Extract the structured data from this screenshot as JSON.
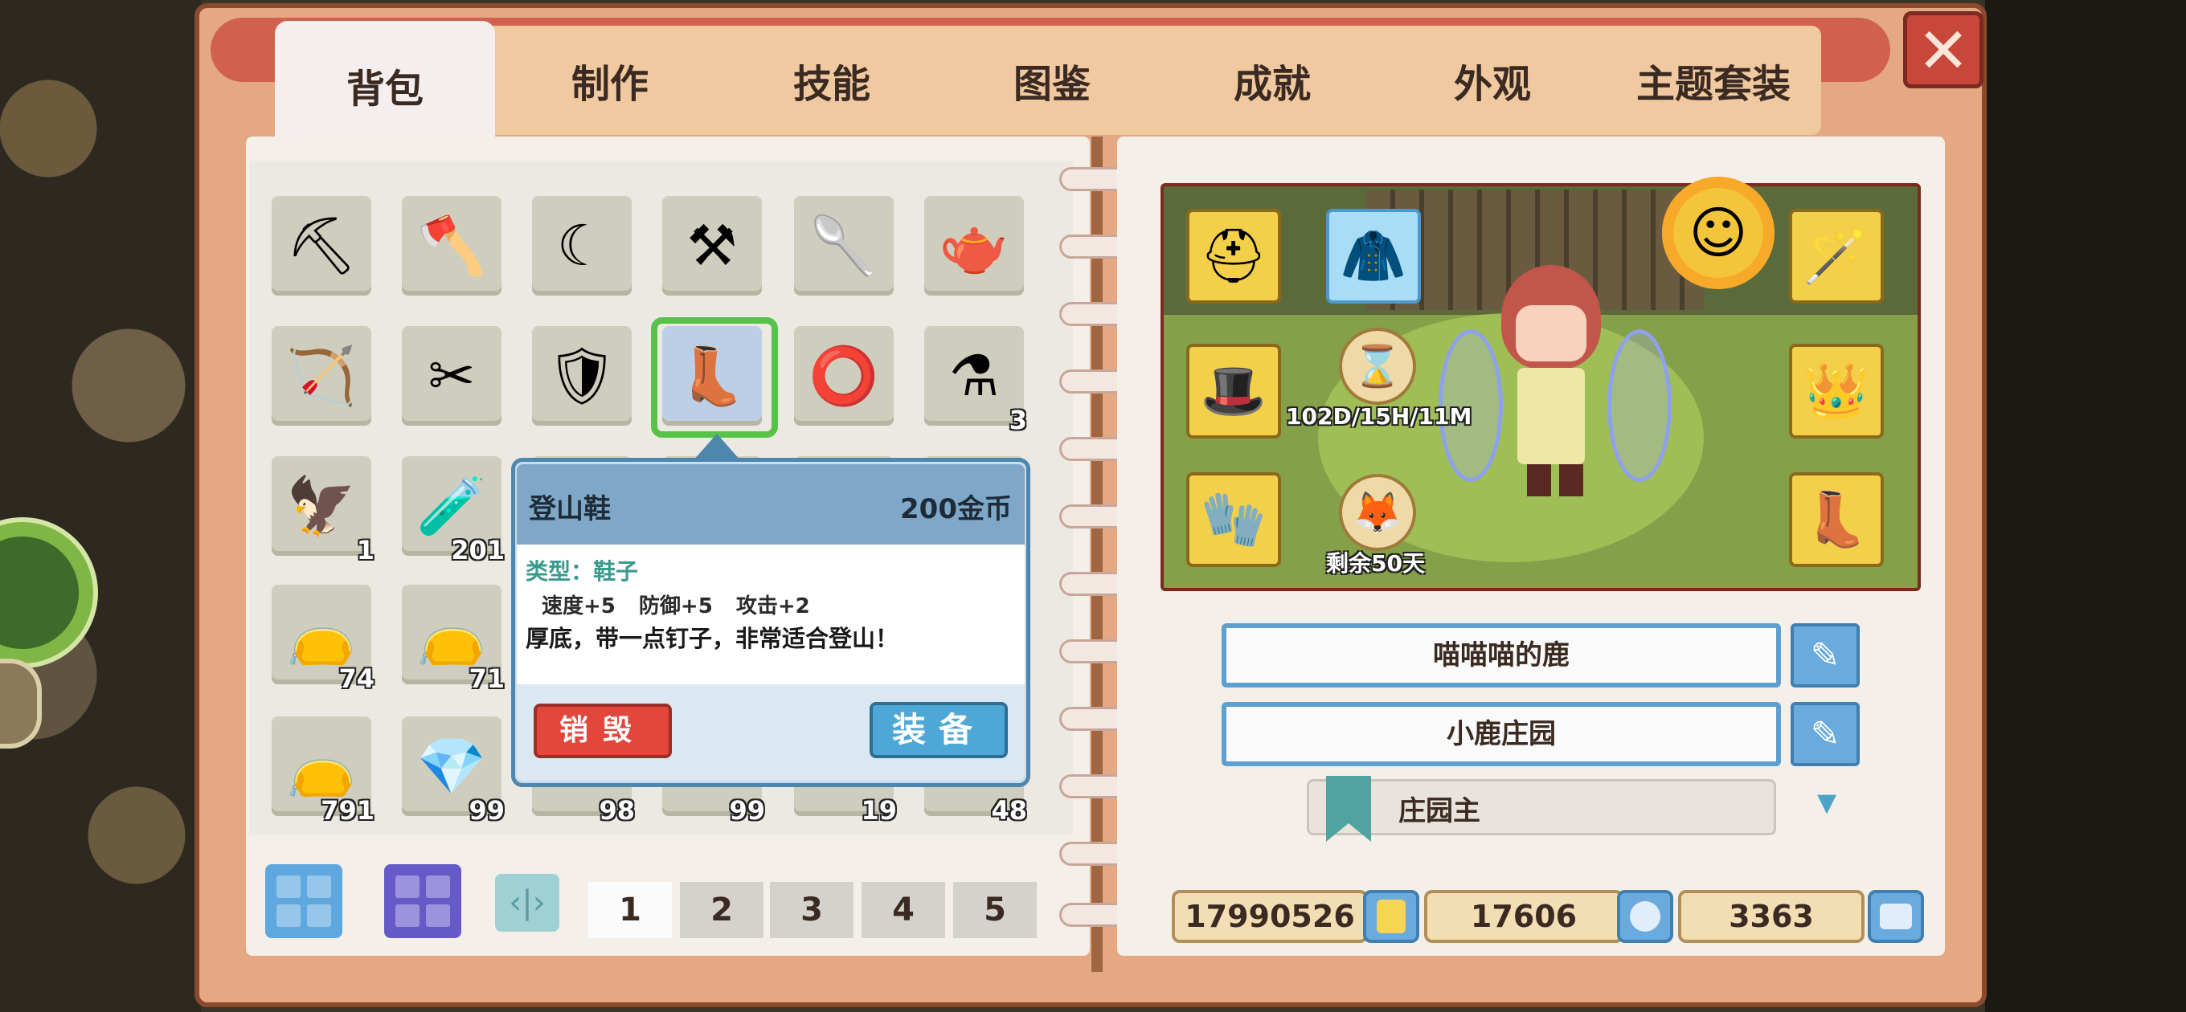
{
  "tabs": [
    "背包",
    "制作",
    "技能",
    "图鉴",
    "成就",
    "外观",
    "主题套装"
  ],
  "close_label": "✕",
  "inventory": {
    "slots": [
      {
        "icon": "pickaxe-icon",
        "glyph": "⛏",
        "count": ""
      },
      {
        "icon": "axe-icon",
        "glyph": "🪓",
        "count": ""
      },
      {
        "icon": "sickle-icon",
        "glyph": "☾",
        "count": ""
      },
      {
        "icon": "hoe-icon",
        "glyph": "⚒",
        "count": ""
      },
      {
        "icon": "shovel-icon",
        "glyph": "🥄",
        "count": ""
      },
      {
        "icon": "teapot-icon",
        "glyph": "🫖",
        "count": ""
      },
      {
        "icon": "bow-icon",
        "glyph": "🏹",
        "count": ""
      },
      {
        "icon": "scissors-icon",
        "glyph": "✂",
        "count": ""
      },
      {
        "icon": "armor-icon",
        "glyph": "🛡",
        "count": ""
      },
      {
        "icon": "boot-icon",
        "glyph": "👢",
        "count": ""
      },
      {
        "icon": "ring-icon",
        "glyph": "⭕",
        "count": ""
      },
      {
        "icon": "potion-icon",
        "glyph": "⚗",
        "count": "3"
      },
      {
        "icon": "bird-icon",
        "glyph": "🦅",
        "count": "1"
      },
      {
        "icon": "bottle-icon",
        "glyph": "🧪",
        "count": "201"
      },
      {
        "icon": "hidden",
        "glyph": "",
        "count": ""
      },
      {
        "icon": "hidden",
        "glyph": "",
        "count": ""
      },
      {
        "icon": "hidden",
        "glyph": "",
        "count": ""
      },
      {
        "icon": "hidden",
        "glyph": "",
        "count": ""
      },
      {
        "icon": "seed-bag-blue-icon",
        "glyph": "👝",
        "count": "74"
      },
      {
        "icon": "seed-bag-red-icon",
        "glyph": "👝",
        "count": "71"
      },
      {
        "icon": "hidden",
        "glyph": "",
        "count": ""
      },
      {
        "icon": "hidden",
        "glyph": "",
        "count": ""
      },
      {
        "icon": "hidden",
        "glyph": "",
        "count": ""
      },
      {
        "icon": "hidden",
        "glyph": "",
        "count": ""
      },
      {
        "icon": "seed-bag-green-icon",
        "glyph": "👝",
        "count": "791"
      },
      {
        "icon": "gem-icon",
        "glyph": "💎",
        "count": "99"
      },
      {
        "icon": "item-icon",
        "glyph": "",
        "count": "98"
      },
      {
        "icon": "item-icon",
        "glyph": "",
        "count": "99"
      },
      {
        "icon": "item-icon",
        "glyph": "",
        "count": "19"
      },
      {
        "icon": "item-icon",
        "glyph": "",
        "count": "48"
      }
    ]
  },
  "tooltip": {
    "name": "登山鞋",
    "price": "200金币",
    "type": "类型：鞋子",
    "stats": "速度+5 防御+5 攻击+2",
    "description": "厚底，带一点钉子，非常适合登山！",
    "destroy_label": "销毁",
    "equip_label": "装备"
  },
  "pages": [
    "1",
    "2",
    "3",
    "4",
    "5"
  ],
  "active_page": "1",
  "character": {
    "timer1": "102D/15H/11M",
    "timer2": "剩余50天",
    "player_name": "喵喵喵的鹿",
    "farm_name": "小鹿庄园",
    "title": "庄园主"
  },
  "currency": {
    "gold": "17990526",
    "diamond": "17606",
    "ticket": "3363"
  },
  "colors": {
    "frame": "#e4a982",
    "accent_blue": "#5d9fd1",
    "select_green": "#56c24a",
    "destroy_red": "#e3463c"
  }
}
